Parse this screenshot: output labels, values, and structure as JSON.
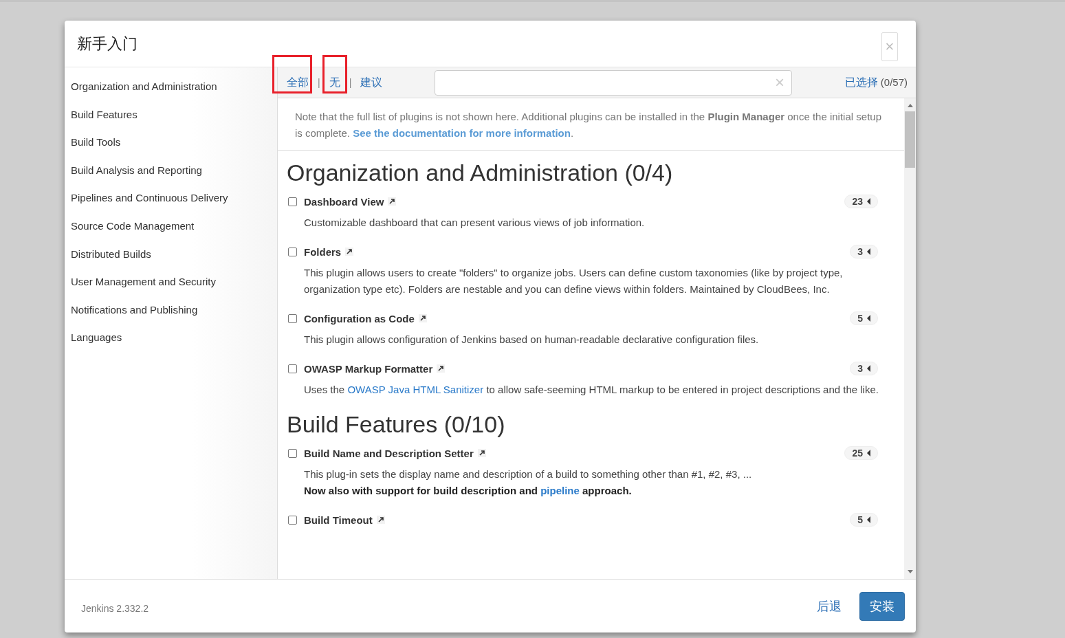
{
  "dialog": {
    "title": "新手入门",
    "close": "×"
  },
  "sidebar": {
    "items": [
      {
        "label": "Organization and Administration"
      },
      {
        "label": "Build Features"
      },
      {
        "label": "Build Tools"
      },
      {
        "label": "Build Analysis and Reporting"
      },
      {
        "label": "Pipelines and Continuous Delivery"
      },
      {
        "label": "Source Code Management"
      },
      {
        "label": "Distributed Builds"
      },
      {
        "label": "User Management and Security"
      },
      {
        "label": "Notifications and Publishing"
      },
      {
        "label": "Languages"
      }
    ]
  },
  "toolbar": {
    "filters": [
      {
        "label": "全部",
        "highlighted": true
      },
      {
        "label": "无",
        "highlighted": true
      },
      {
        "label": "建议",
        "highlighted": false
      }
    ],
    "separator": "|",
    "search": {
      "clear": "×"
    },
    "selected_link": "已选择",
    "selected_count": "(0/57)"
  },
  "note": [
    {
      "text": "Note that the full list of plugins is not shown here. Additional plugins can be installed in the **Plugin Manager** once the initial setup is complete. ",
      "kind": "text"
    },
    {
      "text": "See the documentation for more information",
      "kind": "link"
    },
    {
      "text": ".",
      "kind": "text"
    }
  ],
  "sections": [
    {
      "title": "Organization and Administration (0/4)",
      "plugins": [
        {
          "name": "Dashboard View",
          "checked": false,
          "count": "23",
          "description": [
            {
              "bold": false,
              "parts": [
                {
                  "text": "Customizable dashboard that can present various views of job information.",
                  "kind": "text"
                }
              ]
            }
          ]
        },
        {
          "name": "Folders",
          "checked": false,
          "count": "3",
          "description": [
            {
              "bold": false,
              "parts": [
                {
                  "text": "This plugin allows users to create \"folders\" to organize jobs. Users can define custom taxonomies (like by project type, organization type etc). Folders are nestable and you can define views within folders. Maintained by CloudBees, Inc.",
                  "kind": "text"
                }
              ]
            }
          ]
        },
        {
          "name": "Configuration as Code",
          "checked": false,
          "count": "5",
          "description": [
            {
              "bold": false,
              "parts": [
                {
                  "text": "This plugin allows configuration of Jenkins based on human-readable declarative configuration files.",
                  "kind": "text"
                }
              ]
            }
          ]
        },
        {
          "name": "OWASP Markup Formatter",
          "checked": false,
          "count": "3",
          "description": [
            {
              "bold": false,
              "parts": [
                {
                  "text": "Uses the ",
                  "kind": "text"
                },
                {
                  "text": "OWASP Java HTML Sanitizer",
                  "kind": "link"
                },
                {
                  "text": " to allow safe-seeming HTML markup to be entered in project descriptions and the like.",
                  "kind": "text"
                }
              ]
            }
          ]
        }
      ]
    },
    {
      "title": "Build Features (0/10)",
      "plugins": [
        {
          "name": "Build Name and Description Setter",
          "checked": false,
          "count": "25",
          "description": [
            {
              "bold": false,
              "parts": [
                {
                  "text": "This plug-in sets the display name and description of a build to something other than #1, #2, #3, ...",
                  "kind": "text"
                }
              ]
            },
            {
              "bold": true,
              "parts": [
                {
                  "text": "Now also with support for build description and ",
                  "kind": "text"
                },
                {
                  "text": "pipeline",
                  "kind": "link"
                },
                {
                  "text": " approach.",
                  "kind": "text"
                }
              ]
            }
          ]
        },
        {
          "name": "Build Timeout",
          "checked": false,
          "count": "5"
        }
      ]
    }
  ],
  "footer": {
    "version": "Jenkins 2.332.2",
    "back": "后退",
    "install": "安装"
  }
}
